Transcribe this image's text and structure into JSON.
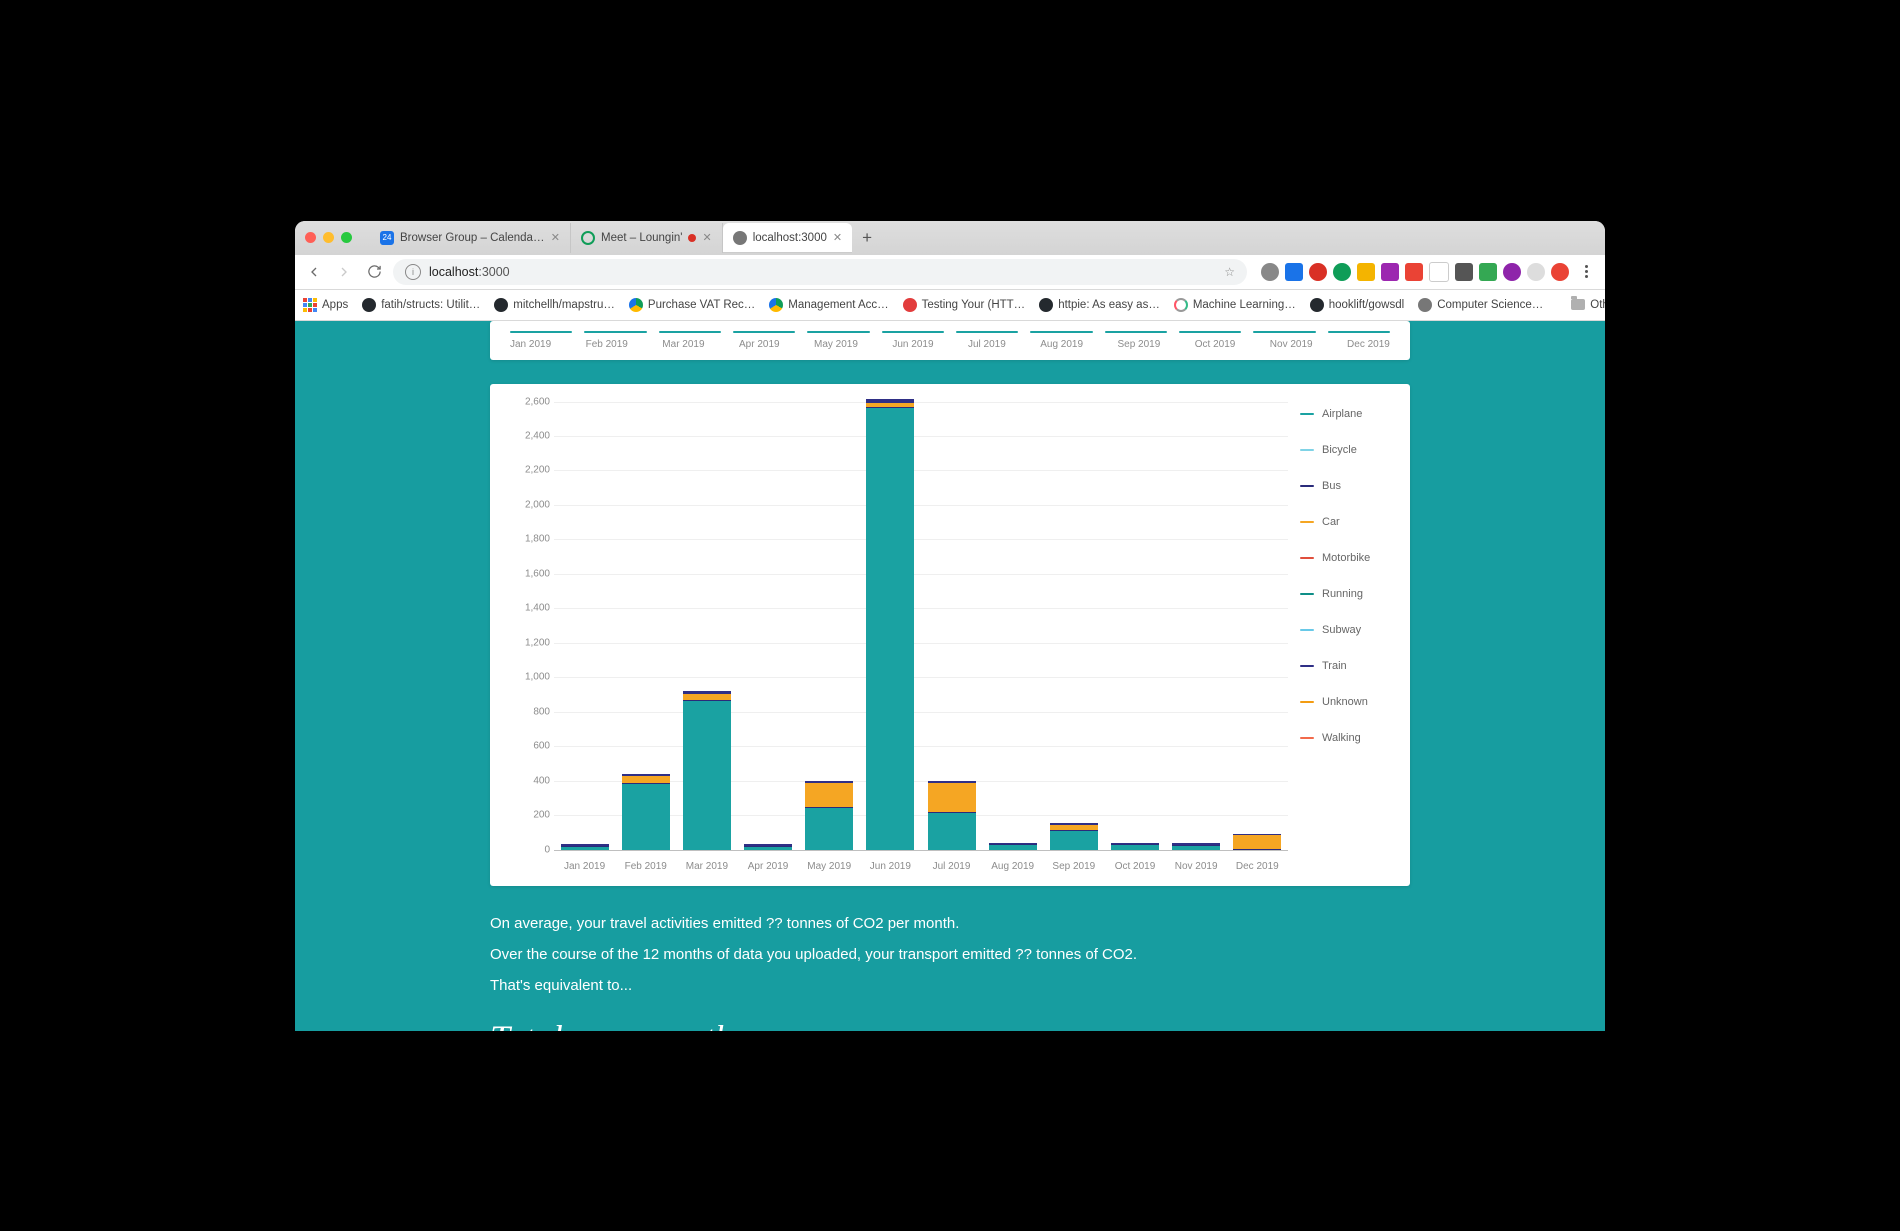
{
  "browser": {
    "tabs": [
      {
        "title": "Browser Group – Calendar - W…",
        "favicon": "blue",
        "faviconText": "24"
      },
      {
        "title": "Meet – Loungin'",
        "favicon": "ring",
        "recording": true
      },
      {
        "title": "localhost:3000",
        "favicon": "globe",
        "active": true
      }
    ],
    "url_display": "localhost:3000",
    "url_emphasis": "localhost",
    "url_rest": ":3000",
    "apps_label": "Apps",
    "bookmarks": [
      {
        "label": "fatih/structs: Utilit…",
        "icon": "gh"
      },
      {
        "label": "mitchellh/mapstru…",
        "icon": "gh"
      },
      {
        "label": "Purchase VAT Rec…",
        "icon": "gdrive"
      },
      {
        "label": "Management Acc…",
        "icon": "gdrive"
      },
      {
        "label": "Testing Your (HTT…",
        "icon": "lb"
      },
      {
        "label": "httpie: As easy as…",
        "icon": "gh"
      },
      {
        "label": "Machine Learning…",
        "icon": "ml"
      },
      {
        "label": "hooklift/gowsdl",
        "icon": "gh"
      },
      {
        "label": "Computer Science…",
        "icon": "cs"
      }
    ],
    "other_bookmarks": "Other Bookmarks"
  },
  "page": {
    "blurb1": "On average, your travel activities emitted ?? tonnes of CO2 per month.",
    "blurb2": "Over the course of the 12 months of data you uploaded, your transport emitted ?? tonnes of CO2.",
    "blurb3": "That's equivalent to...",
    "section_title": "Totals per month"
  },
  "chart_data": {
    "type": "bar",
    "stacked": true,
    "categories": [
      "Jan 2019",
      "Feb 2019",
      "Mar 2019",
      "Apr 2019",
      "May 2019",
      "Jun 2019",
      "Jul 2019",
      "Aug 2019",
      "Sep 2019",
      "Oct 2019",
      "Nov 2019",
      "Dec 2019"
    ],
    "ylim": [
      0,
      2600
    ],
    "yticks": [
      0,
      200,
      400,
      600,
      800,
      1000,
      1200,
      1400,
      1600,
      1800,
      2000,
      2200,
      2400,
      2600
    ],
    "series": [
      {
        "name": "Airplane",
        "color": "#1aa2a2",
        "values": [
          15,
          380,
          860,
          15,
          240,
          2560,
          210,
          25,
          110,
          25,
          20,
          0
        ]
      },
      {
        "name": "Bicycle",
        "color": "#7fd3e6",
        "values": [
          0,
          0,
          0,
          0,
          0,
          0,
          0,
          0,
          0,
          0,
          0,
          0
        ]
      },
      {
        "name": "Bus",
        "color": "#2a2b7a",
        "values": [
          5,
          5,
          10,
          5,
          5,
          10,
          5,
          5,
          5,
          5,
          5,
          5
        ]
      },
      {
        "name": "Car",
        "color": "#f5a623",
        "values": [
          0,
          40,
          30,
          0,
          140,
          20,
          170,
          0,
          30,
          0,
          0,
          80
        ]
      },
      {
        "name": "Motorbike",
        "color": "#e04f3c",
        "values": [
          0,
          0,
          0,
          0,
          0,
          0,
          0,
          0,
          0,
          0,
          0,
          0
        ]
      },
      {
        "name": "Running",
        "color": "#0e8e87",
        "values": [
          0,
          0,
          0,
          0,
          0,
          0,
          0,
          0,
          0,
          0,
          0,
          0
        ]
      },
      {
        "name": "Subway",
        "color": "#68c9e8",
        "values": [
          0,
          0,
          0,
          0,
          0,
          0,
          0,
          0,
          0,
          0,
          0,
          0
        ]
      },
      {
        "name": "Train",
        "color": "#2f2f86",
        "values": [
          10,
          15,
          20,
          10,
          15,
          25,
          15,
          5,
          10,
          5,
          10,
          5
        ]
      },
      {
        "name": "Unknown",
        "color": "#f39c12",
        "values": [
          0,
          0,
          0,
          0,
          0,
          0,
          0,
          0,
          0,
          0,
          0,
          0
        ]
      },
      {
        "name": "Walking",
        "color": "#f26a4b",
        "values": [
          0,
          0,
          0,
          0,
          0,
          0,
          0,
          0,
          0,
          0,
          0,
          0
        ]
      }
    ]
  }
}
